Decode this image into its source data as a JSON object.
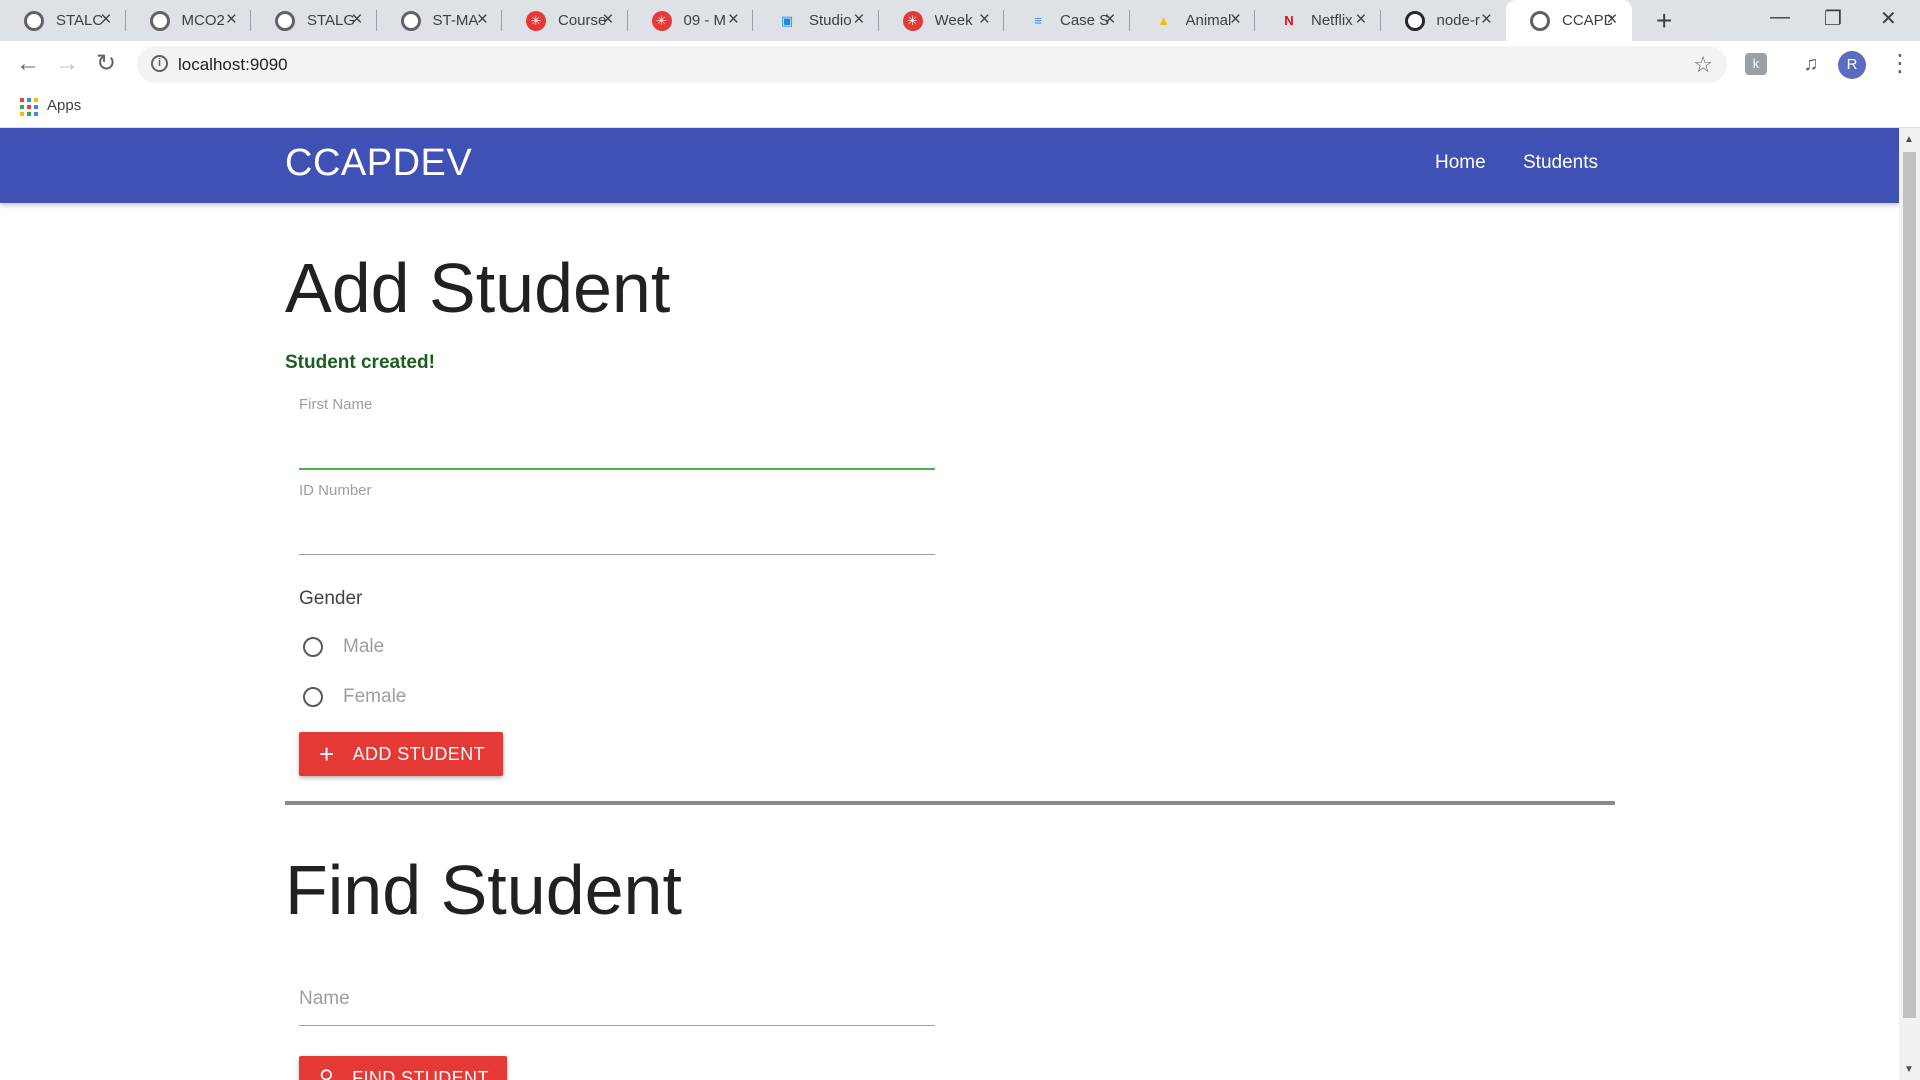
{
  "browser": {
    "tabs": [
      {
        "title": "STALC",
        "favicon": "globe-icon",
        "color": "#5f6368"
      },
      {
        "title": "MCO2",
        "favicon": "globe-icon",
        "color": "#5f6368"
      },
      {
        "title": "STALG",
        "favicon": "globe-icon",
        "color": "#5f6368"
      },
      {
        "title": "ST-MA",
        "favicon": "globe-icon",
        "color": "#5f6368"
      },
      {
        "title": "Course",
        "favicon": "canvas-icon",
        "color": "#e53935"
      },
      {
        "title": "09 - M",
        "favicon": "canvas-icon",
        "color": "#e53935"
      },
      {
        "title": "Studio",
        "favicon": "studio-icon",
        "color": "#1e88e5"
      },
      {
        "title": "Week",
        "favicon": "canvas-icon",
        "color": "#e53935"
      },
      {
        "title": "Case S",
        "favicon": "docs-icon",
        "color": "#4285f4"
      },
      {
        "title": "Animal",
        "favicon": "drive-icon",
        "color": "#fbbc04"
      },
      {
        "title": "Netflix",
        "favicon": "netflix-icon",
        "color": "#e50914"
      },
      {
        "title": "node-r",
        "favicon": "github-icon",
        "color": "#24292e"
      },
      {
        "title": "CCAPD",
        "favicon": "globe-icon",
        "color": "#5f6368"
      }
    ],
    "url": "localhost:9090",
    "bookmarks_apps_label": "Apps",
    "profile_initial": "R"
  },
  "app": {
    "brand": "CCAPDEV",
    "nav": [
      {
        "label": "Home"
      },
      {
        "label": "Students"
      }
    ],
    "theme_color": "#3f51b5",
    "accent_color": "#e53935"
  },
  "add_student": {
    "heading": "Add Student",
    "status_message": "Student created!",
    "first_name_label": "First Name",
    "first_name_value": "",
    "id_number_label": "ID Number",
    "id_number_value": "",
    "gender_label": "Gender",
    "gender_options": [
      {
        "label": "Male",
        "checked": false
      },
      {
        "label": "Female",
        "checked": false
      }
    ],
    "submit_label": "ADD STUDENT",
    "submit_icon": "plus-icon"
  },
  "find_student": {
    "heading": "Find Student",
    "name_placeholder": "Name",
    "submit_label": "FIND STUDENT",
    "submit_icon": "search-icon"
  }
}
